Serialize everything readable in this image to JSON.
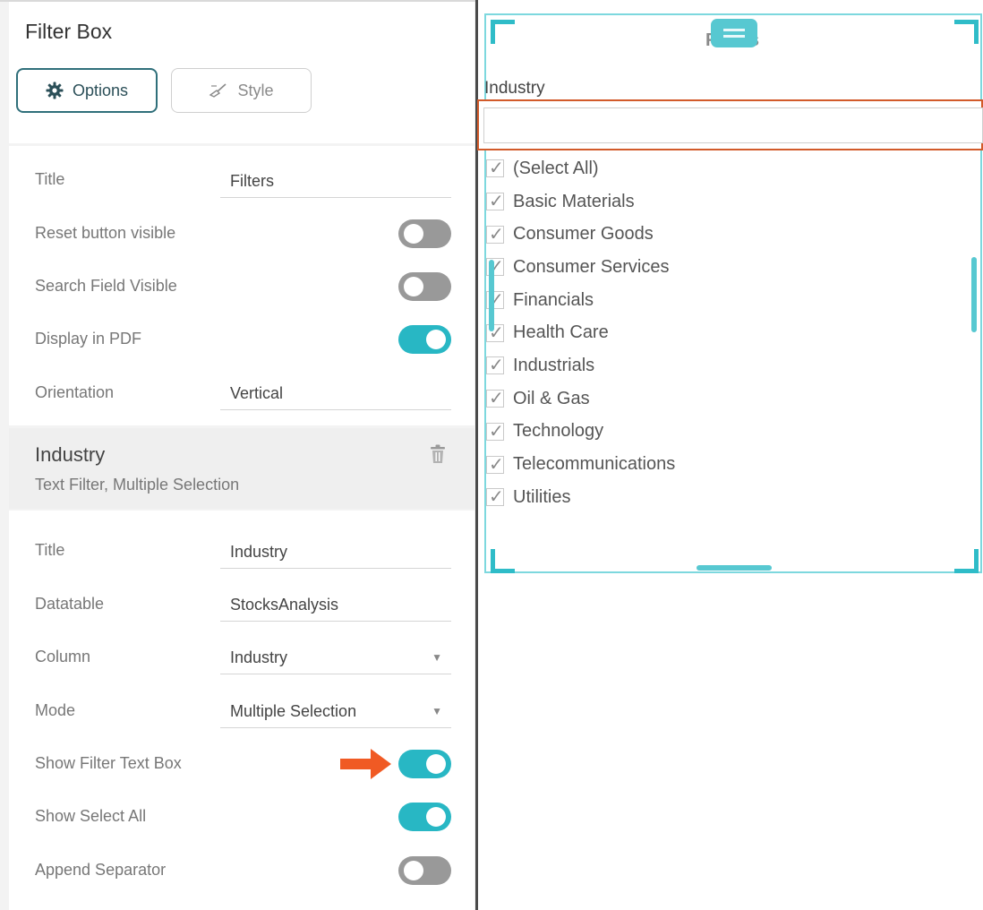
{
  "panel": {
    "title": "Filter Box",
    "tabs": [
      {
        "label": "Options",
        "active": true,
        "icon": "gear-icon"
      },
      {
        "label": "Style",
        "active": false,
        "icon": "brush-icon"
      }
    ]
  },
  "general": {
    "title_label": "Title",
    "title_value": "Filters",
    "reset_label": "Reset button visible",
    "reset_on": false,
    "search_label": "Search Field Visible",
    "search_on": false,
    "pdf_label": "Display in PDF",
    "pdf_on": true,
    "orientation_label": "Orientation",
    "orientation_value": "Vertical"
  },
  "filter": {
    "name": "Industry",
    "description": "Text Filter, Multiple Selection",
    "title_label": "Title",
    "title_value": "Industry",
    "datatable_label": "Datatable",
    "datatable_value": "StocksAnalysis",
    "column_label": "Column",
    "column_value": "Industry",
    "mode_label": "Mode",
    "mode_value": "Multiple Selection",
    "show_textbox_label": "Show Filter Text Box",
    "show_textbox_on": true,
    "show_selectall_label": "Show Select All",
    "show_selectall_on": true,
    "separator_label": "Append Separator",
    "separator_on": false
  },
  "preview": {
    "title": "Filters",
    "column_label": "Industry",
    "items": [
      "(Select All)",
      "Basic Materials",
      "Consumer Goods",
      "Consumer Services",
      "Financials",
      "Health Care",
      "Industrials",
      "Oil & Gas",
      "Technology",
      "Telecommunications",
      "Utilities"
    ]
  },
  "colors": {
    "accent": "#28b7c4",
    "toggle_off": "#999999",
    "highlight": "#d25a2a",
    "arrow": "#f05a24"
  }
}
